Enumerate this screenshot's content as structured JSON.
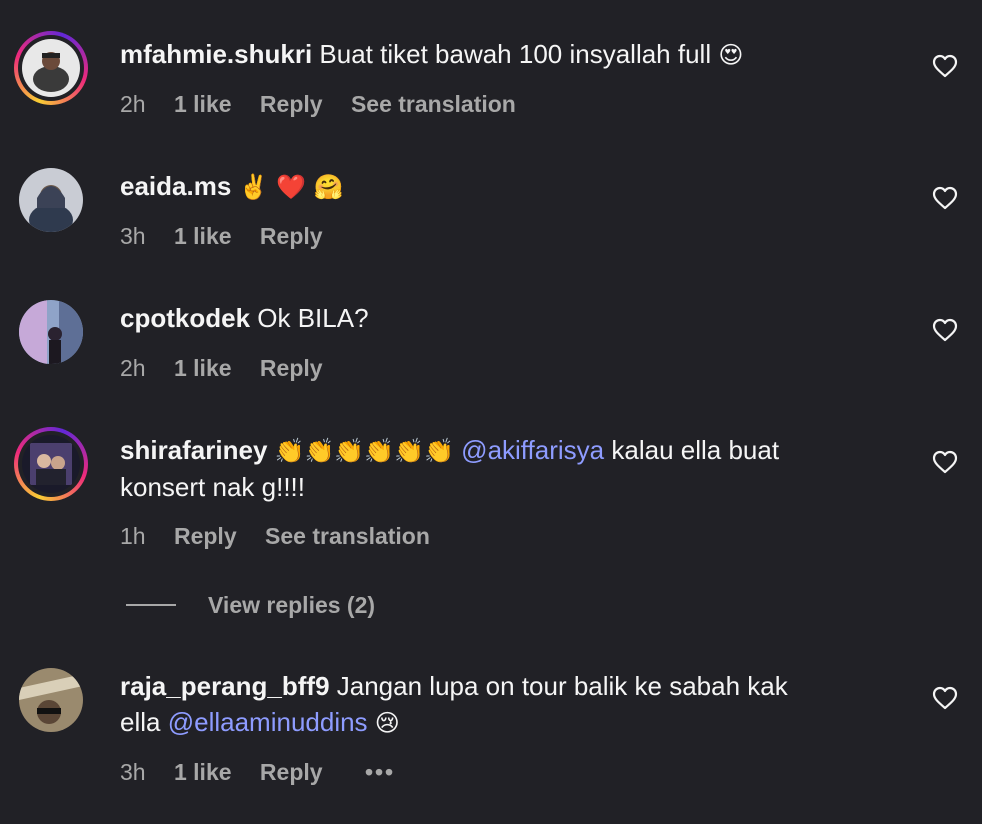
{
  "comments": [
    {
      "username": "mfahmie.shukri",
      "text": "Buat tiket bawah 100 insyallah full",
      "emoji": "😍",
      "time": "2h",
      "likes": "1 like",
      "reply": "Reply",
      "translate": "See translation",
      "has_story_ring": true
    },
    {
      "username": "eaida.ms",
      "text": "",
      "emoji": "✌️ ❤️ 🤗",
      "time": "3h",
      "likes": "1 like",
      "reply": "Reply",
      "has_story_ring": false
    },
    {
      "username": "cpotkodek",
      "text": "Ok BILA?",
      "time": "2h",
      "likes": "1 like",
      "reply": "Reply",
      "has_story_ring": false
    },
    {
      "username": "shirafariney",
      "emoji": "👏👏👏👏👏👏",
      "mention": "@akiffarisya",
      "text_after": "kalau ella buat",
      "text_line2": "konsert nak g!!!!",
      "time": "1h",
      "reply": "Reply",
      "translate": "See translation",
      "view_replies": "View replies (2)",
      "has_story_ring": true
    },
    {
      "username": "raja_perang_bff9",
      "text": "Jangan lupa on tour balik ke sabah kak",
      "text_line2_prefix": "ella",
      "mention": "@ellaaminuddins",
      "emoji": "😢",
      "time": "3h",
      "likes": "1 like",
      "reply": "Reply",
      "more": "•••",
      "has_story_ring": false
    }
  ],
  "icons": {
    "like": "heart-outline-icon",
    "more": "more-horizontal-icon"
  },
  "colors": {
    "background": "#212126",
    "text": "#f5f5f5",
    "secondary": "#a8a8a8",
    "mention": "#8e9cff"
  }
}
